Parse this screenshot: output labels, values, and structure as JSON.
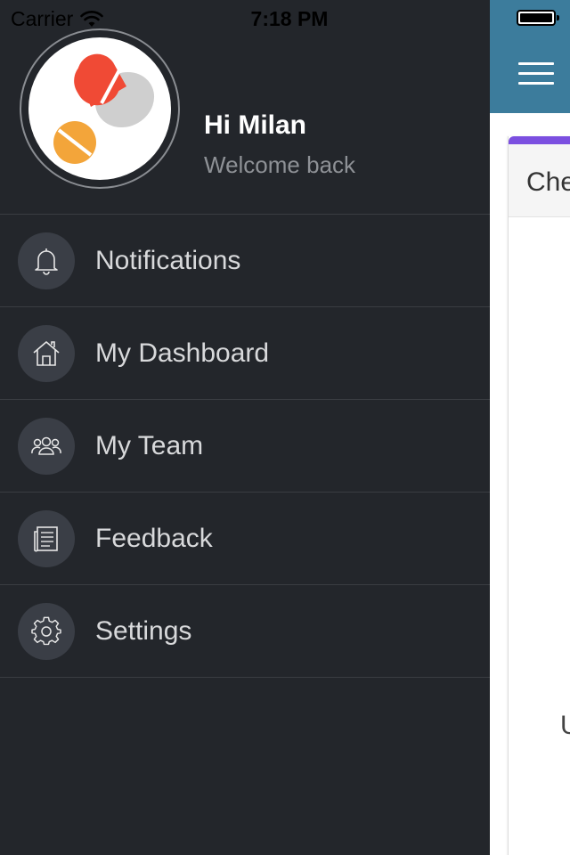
{
  "status_bar": {
    "carrier": "Carrier",
    "time": "7:18 PM"
  },
  "profile": {
    "greeting": "Hi Milan",
    "subtitle": "Welcome back"
  },
  "menu": {
    "items": [
      {
        "label": "Notifications",
        "icon": "bell-icon"
      },
      {
        "label": "My Dashboard",
        "icon": "home-icon"
      },
      {
        "label": "My Team",
        "icon": "team-icon"
      },
      {
        "label": "Feedback",
        "icon": "document-icon"
      },
      {
        "label": "Settings",
        "icon": "gear-icon"
      }
    ]
  },
  "main": {
    "card_title": "Che",
    "body_text": "U"
  },
  "colors": {
    "drawer_bg": "#23262b",
    "header_bg": "#3c7c9c",
    "accent": "#7b4fe0"
  }
}
